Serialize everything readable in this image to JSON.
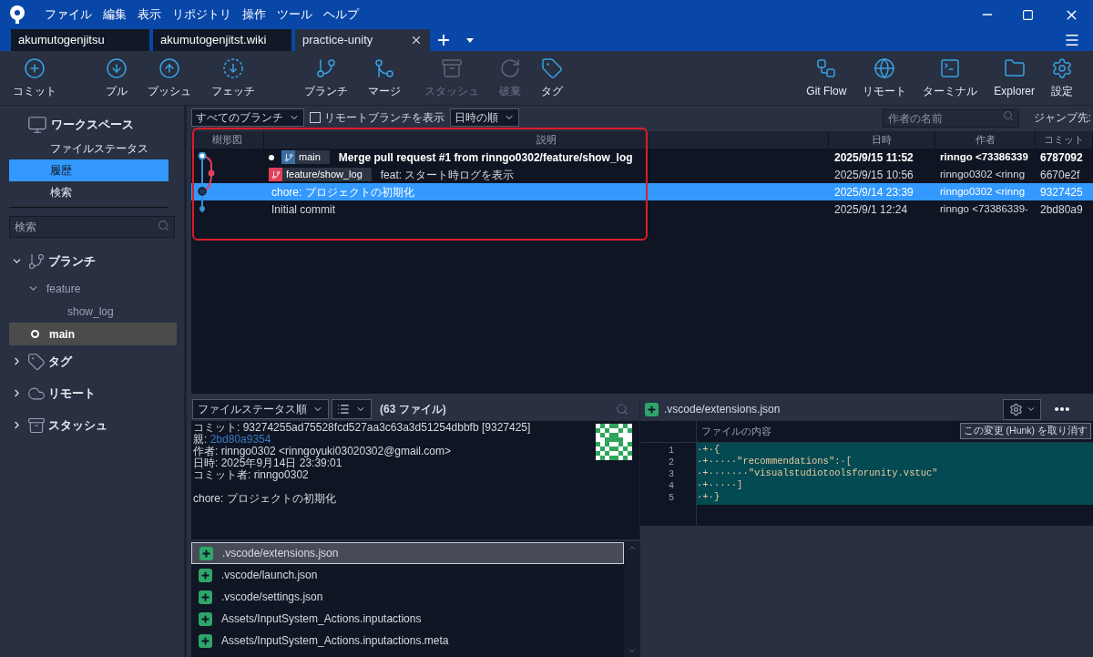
{
  "menu": [
    "ファイル",
    "編集",
    "表示",
    "リポジトリ",
    "操作",
    "ツール",
    "ヘルプ"
  ],
  "tabs": [
    {
      "label": "akumutogenjitsu",
      "selected": false
    },
    {
      "label": "akumutogenjitst.wiki",
      "selected": false
    },
    {
      "label": "practice-unity",
      "selected": true
    }
  ],
  "toolbar": {
    "left": [
      {
        "label": "コミット",
        "disabled": false
      },
      {
        "label": "プル",
        "disabled": false
      },
      {
        "label": "プッシュ",
        "disabled": false
      },
      {
        "label": "フェッチ",
        "disabled": false
      },
      {
        "label": "ブランチ",
        "disabled": false
      },
      {
        "label": "マージ",
        "disabled": false
      },
      {
        "label": "スタッシュ",
        "disabled": true
      },
      {
        "label": "破棄",
        "disabled": true
      },
      {
        "label": "タグ",
        "disabled": false
      }
    ],
    "right": [
      {
        "label": "Git Flow",
        "disabled": false
      },
      {
        "label": "リモート",
        "disabled": false
      },
      {
        "label": "ターミナル",
        "disabled": false
      },
      {
        "label": "Explorer",
        "disabled": false
      },
      {
        "label": "設定",
        "disabled": false
      }
    ]
  },
  "sidebar": {
    "workspace": {
      "title": "ワークスペース",
      "items": [
        {
          "label": "ファイルステータス",
          "selected": false
        },
        {
          "label": "履歴",
          "selected": true
        },
        {
          "label": "検索",
          "selected": false
        }
      ]
    },
    "search": {
      "placeholder": "検索"
    },
    "sections": [
      {
        "title": "ブランチ",
        "expanded": true,
        "children": [
          {
            "label": "feature",
            "expanded": true,
            "children": [
              {
                "label": "show_log",
                "current": false,
                "selected": false
              }
            ]
          },
          {
            "label": "main",
            "current": true,
            "selected": true
          }
        ]
      },
      {
        "title": "タグ",
        "expanded": false
      },
      {
        "title": "リモート",
        "expanded": false
      },
      {
        "title": "スタッシュ",
        "expanded": false
      }
    ]
  },
  "filter_bar": {
    "branch_filter": "すべてのブランチ",
    "show_remote": {
      "label": "リモートブランチを表示",
      "checked": false
    },
    "sort": "日時の順",
    "author_search": {
      "placeholder": "作者の名前"
    },
    "jump_label": "ジャンプ先:"
  },
  "commit_table": {
    "columns": [
      "樹形図",
      "説明",
      "日時",
      "作者",
      "コミット"
    ],
    "rows": [
      {
        "head": true,
        "tags": [
          {
            "label": "main",
            "color": "#3a6ea5"
          }
        ],
        "message": "Merge pull request #1 from rinngo0302/feature/show_log",
        "date": "2025/9/15 11:52",
        "author": "rinngo <73386339",
        "hash": "6787092",
        "bold": true,
        "selected": false
      },
      {
        "head": false,
        "tags": [
          {
            "label": "feature/show_log",
            "color": "#e0405a"
          }
        ],
        "message": "feat: スタート時ログを表示",
        "date": "2025/9/15 10:56",
        "author": "rinngo0302 <rinng",
        "hash": "6670e2f",
        "bold": false,
        "selected": false
      },
      {
        "head": false,
        "tags": [],
        "message": "chore: プロジェクトの初期化",
        "date": "2025/9/14 23:39",
        "author": "rinngo0302 <rinng",
        "hash": "9327425",
        "bold": false,
        "selected": true
      },
      {
        "head": false,
        "tags": [],
        "message": "Initial commit",
        "date": "2025/9/1 12:24",
        "author": "rinngo <73386339-",
        "hash": "2bd80a9",
        "bold": false,
        "selected": false
      }
    ]
  },
  "files_bar": {
    "sort": "ファイルステータス順",
    "count": "(63 ファイル)"
  },
  "commit_details": {
    "commit": {
      "label": "コミット:",
      "value": "93274255ad75528fcd527aa3c63a3d51254dbbfb [9327425]"
    },
    "parent": {
      "label": "親:",
      "value": "2bd80a9354"
    },
    "author": {
      "label": "作者:",
      "value": "rinngo0302 <rinngoyuki03020302@gmail.com>"
    },
    "date": {
      "label": "日時:",
      "value": "2025年9月14日 23:39:01"
    },
    "committer": {
      "label": "コミット者:",
      "value": "rinngo0302"
    },
    "message": "chore: プロジェクトの初期化"
  },
  "files": [
    {
      "path": ".vscode/extensions.json",
      "selected": true
    },
    {
      "path": ".vscode/launch.json",
      "selected": false
    },
    {
      "path": ".vscode/settings.json",
      "selected": false
    },
    {
      "path": "Assets/InputSystem_Actions.inputactions",
      "selected": false
    },
    {
      "path": "Assets/InputSystem_Actions.inputactions.meta",
      "selected": false
    }
  ],
  "diff": {
    "file": ".vscode/extensions.json",
    "column": "ファイルの内容",
    "discard_button": "この変更 (Hunk) を取り消す",
    "lines": [
      {
        "number": "1",
        "text": "·+·{"
      },
      {
        "number": "2",
        "text": "·+·····\"recommendations\":·["
      },
      {
        "number": "3",
        "text": "·+·······\"visualstudiotoolsforunity.vstuc\""
      },
      {
        "number": "4",
        "text": "·+·····]"
      },
      {
        "number": "5",
        "text": "·+·}"
      }
    ]
  }
}
